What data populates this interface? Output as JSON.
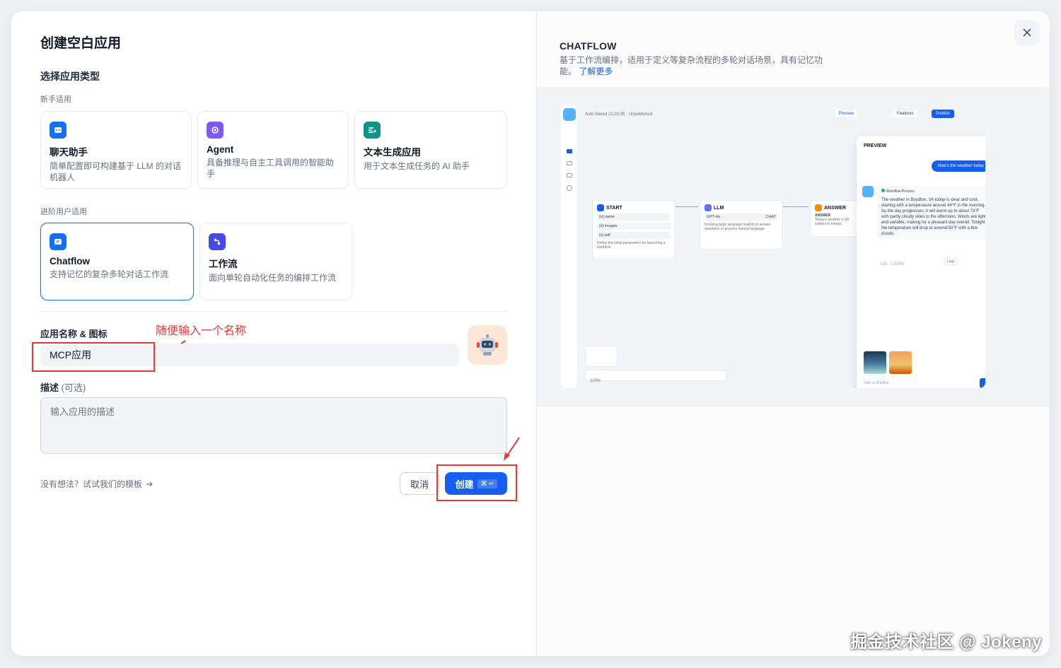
{
  "left": {
    "title": "创建空白应用",
    "section_label": "选择应用类型",
    "beginner_label": "新手适用",
    "advanced_label": "进阶用户适用",
    "cards": [
      {
        "name": "聊天助手",
        "desc": "简单配置即可构建基于 LLM 的对话机器人",
        "color": "#1570ef",
        "icon": "chat-bot-icon"
      },
      {
        "name": "Agent",
        "desc": "具备推理与自主工具调用的智能助手",
        "color": "#7a5af8",
        "icon": "agent-icon"
      },
      {
        "name": "文本生成应用",
        "desc": "用于文本生成任务的 AI 助手",
        "color": "#0e9384",
        "icon": "text-gen-icon"
      },
      {
        "name": "Chatflow",
        "desc": "支持记忆的复杂多轮对话工作流",
        "color": "#1570ef",
        "icon": "chatflow-icon",
        "selected": true
      },
      {
        "name": "工作流",
        "desc": "面向单轮自动化任务的编排工作流",
        "color": "#444ce7",
        "icon": "workflow-icon"
      }
    ],
    "name_label": "应用名称 & 图标",
    "name_value": "MCP应用",
    "annotation": "随便输入一个名称",
    "desc_label": "描述",
    "desc_optional": "(可选)",
    "desc_placeholder": "输入应用的描述",
    "template_link": "没有想法？试试我们的模板",
    "cancel": "取消",
    "create": "创建",
    "create_kbd": "⌘ ↵"
  },
  "right": {
    "title": "CHATFLOW",
    "desc": "基于工作流编排，适用于定义等复杂流程的多轮对话场景，具有记忆功能。",
    "learn_more": "了解更多",
    "preview": {
      "autosave": "Auto-Saved 21:02:35 · Unpublished",
      "preview_btn": "Preview",
      "features_btn": "Features",
      "publish_btn": "Publish",
      "zoom": "100%",
      "nodes": {
        "start": {
          "title": "START",
          "rows": [
            "{x} name",
            "{x} images",
            "{x} pdf"
          ],
          "required": "REQUIRED",
          "note": "Define the initial parameters for launching a workflow"
        },
        "llm": {
          "title": "LLM",
          "model": "GPT-4o",
          "mode": "CHAT",
          "note": "Invoking large language models to answer questions or process natural language"
        },
        "answer": {
          "title": "ANSWER",
          "label": "ANSWER",
          "text": "Today's weather is {{#",
          "text2": "entities to extract"
        }
      },
      "panel_title": "PREVIEW",
      "user_msg": "How's the weather today",
      "workflow_process": "Workflow Process",
      "answer_text": "The weather in Boydton, VA today is clear and cool, starting with a temperature around 44°F in the morning. As the day progresses, it will warm up to about 73°F with partly cloudy skies in the afternoon. Winds are light and variable, making for a pleasant day overall. Tonight, the temperature will drop to around 50°F with a few clouds.",
      "meta": "5.8s · 1:20 PM",
      "logs": "Logs",
      "input_placeholder": "Talk to DifyBot"
    }
  },
  "watermark": "掘金技术社区 @ Jokeny"
}
